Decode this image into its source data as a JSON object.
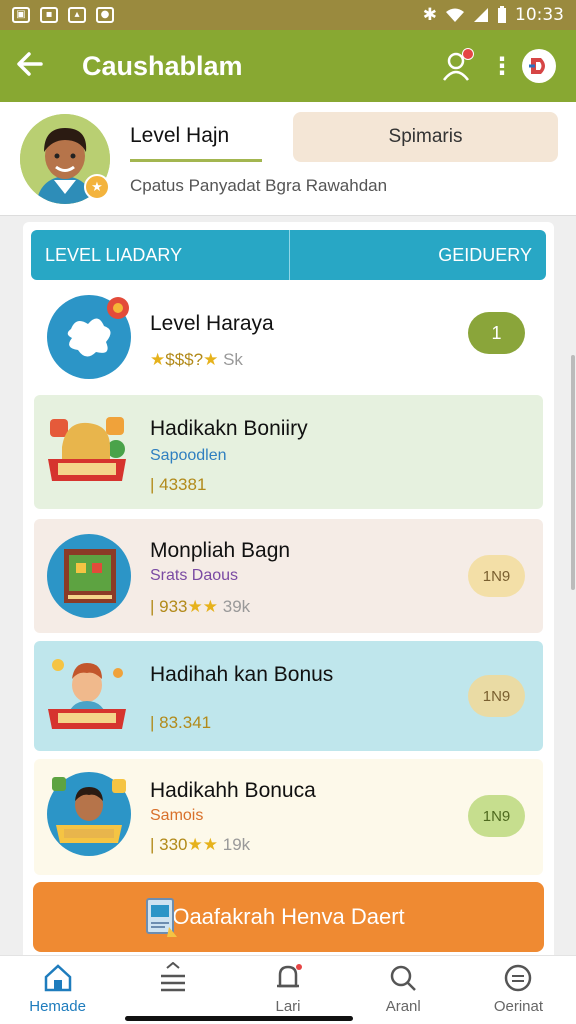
{
  "status_bar": {
    "time": "10:33"
  },
  "app_bar": {
    "title": "Caushablam",
    "back_icon": "arrow-left-icon"
  },
  "profile": {
    "name": "Level Hajn",
    "status": "Cpatus Panyadat Bgra Rawahdan",
    "button_label": "Spimaris"
  },
  "tabs": {
    "left": "LEVEL LIADARY",
    "right": "GEIDUERY"
  },
  "rows": [
    {
      "title": "Level Haraya",
      "subtitle": "",
      "stars_text": "$$$?",
      "stars_tail": "Sk",
      "pill": "1",
      "pill_color": "#8aa53a",
      "bg": "#ffffff"
    },
    {
      "title": "Hadikakn Boniiry",
      "subtitle": "Sapoodlen",
      "stars_text": "| 43381",
      "stars_tail": "",
      "pill": "",
      "pill_color": "",
      "bg": "#e6f1df"
    },
    {
      "title": "Monpliah Bagn",
      "subtitle": "Srats Daous",
      "stars_text": "| 933",
      "stars_tail": "39k",
      "pill": "1N9",
      "pill_color": "#f3dfa7",
      "bg": "#f5ece6"
    },
    {
      "title": "Hadihah kan Bonus",
      "subtitle": "",
      "stars_text": "| 83.341",
      "stars_tail": "",
      "pill": "1N9",
      "pill_color": "#eadba4",
      "bg": "#bfe6ec"
    },
    {
      "title": "Hadikahh Bonuca",
      "subtitle": "Samois",
      "stars_text": "| 330",
      "stars_tail": "19k",
      "pill": "1N9",
      "pill_color": "#c6de8e",
      "bg": "#fdf9ea"
    }
  ],
  "cta": {
    "label": "Oaafakrah Henva Daert"
  },
  "nav": [
    {
      "label": "Hemade",
      "icon": "home-icon"
    },
    {
      "label": "",
      "icon": "menu-icon"
    },
    {
      "label": "Lari",
      "icon": "bell-icon"
    },
    {
      "label": "Aranl",
      "icon": "search-icon"
    },
    {
      "label": "Oerinat",
      "icon": "chat-icon"
    }
  ],
  "colors": {
    "app_bar": "#88a832",
    "tab_bar": "#28a7c5",
    "cta": "#ef8a32",
    "nav_active": "#1e7cbd"
  }
}
